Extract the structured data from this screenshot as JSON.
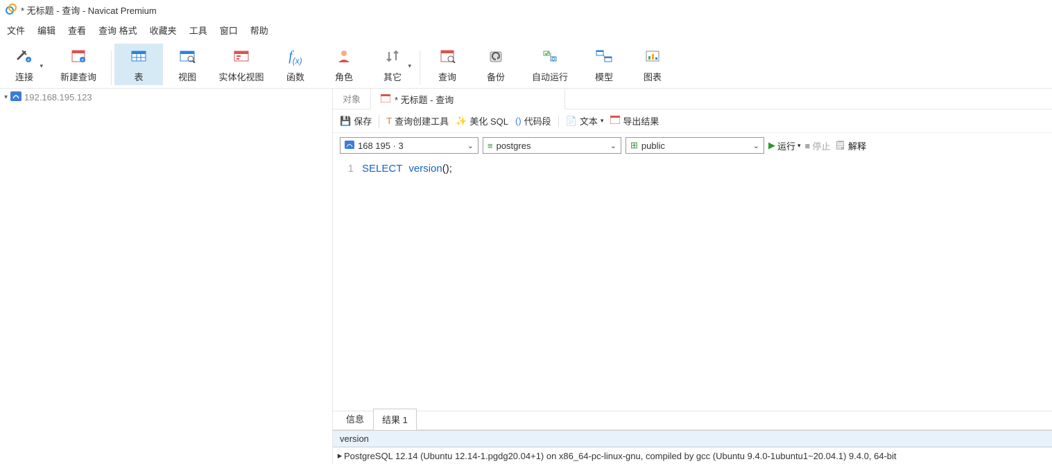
{
  "title": "* 无标题 - 查询 - Navicat Premium",
  "menu": [
    "文件",
    "编辑",
    "查看",
    "查询 格式",
    "收藏夹",
    "工具",
    "窗口",
    "帮助"
  ],
  "toolbar": {
    "connect": "连接",
    "newQuery": "新建查询",
    "table": "表",
    "view": "视图",
    "mview": "实体化视图",
    "function": "函数",
    "role": "角色",
    "other": "其它",
    "query": "查询",
    "backup": "备份",
    "autorun": "自动运行",
    "model": "模型",
    "chart": "图表"
  },
  "tree": {
    "item0": "192.168.195.123"
  },
  "tabObjects": "对象",
  "tabQuery": "* 无标题 - 查询",
  "qbar": {
    "save": "保存",
    "builder": "查询创建工具",
    "beautify": "美化 SQL",
    "snippet": "代码段",
    "text": "文本",
    "export": "导出结果"
  },
  "combo": {
    "conn": "168 195 · 3",
    "db": "postgres",
    "schema": "public"
  },
  "actions": {
    "run": "运行",
    "stop": "停止",
    "explain": "解释"
  },
  "code": {
    "lineNo": "1",
    "kw": "SELECT",
    "fn": "version",
    "tail": "();"
  },
  "resultTabs": {
    "info": "信息",
    "result1": "结果 1"
  },
  "result": {
    "col": "version",
    "row0": "PostgreSQL 12.14 (Ubuntu 12.14-1.pgdg20.04+1) on x86_64-pc-linux-gnu, compiled by gcc (Ubuntu 9.4.0-1ubuntu1~20.04.1) 9.4.0, 64-bit"
  }
}
